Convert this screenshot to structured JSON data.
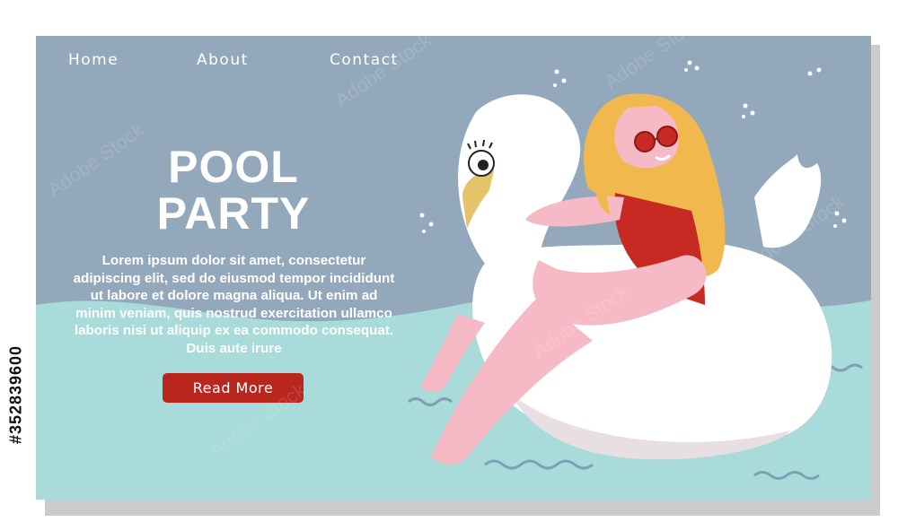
{
  "nav": {
    "items": [
      {
        "label": "Home"
      },
      {
        "label": "About"
      },
      {
        "label": "Contact"
      }
    ]
  },
  "hero": {
    "title_line1": "POOL",
    "title_line2": "PARTY",
    "body": "Lorem ipsum dolor sit amet, consectetur adipiscing elit, sed do eiusmod tempor incididunt ut labore et dolore magna aliqua. Ut enim ad minim veniam, quis nostrud exercitation ullamco laboris nisi ut aliquip ex ea commodo consequat. Duis aute irure",
    "button_label": "Read More"
  },
  "side_caption": "#352839600",
  "colors": {
    "background": "#93a9bb",
    "water": "#a8dbd9",
    "button": "#b8261e",
    "text": "#ffffff"
  }
}
